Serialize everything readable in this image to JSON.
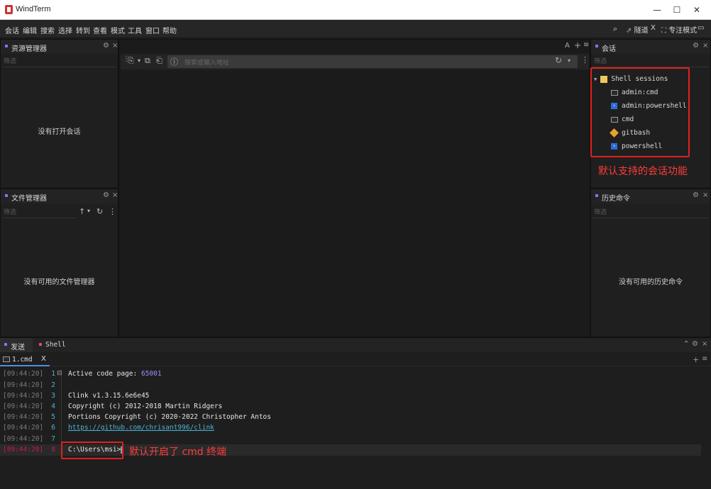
{
  "window": {
    "title": "WindTerm",
    "minimize": "—",
    "maximize": "☐",
    "close": "✕"
  },
  "menu": [
    "会话",
    "编辑",
    "搜索",
    "选择",
    "转到",
    "查看",
    "模式",
    "工具",
    "窗口",
    "帮助"
  ],
  "right_tools": {
    "search": "⌕",
    "tunnel": "隧道",
    "x": "X",
    "focus": "专注模式",
    "layout": "▭"
  },
  "explorer": {
    "title": "资源管理器",
    "filter": "筛选",
    "empty": "没有打开会话"
  },
  "files": {
    "title": "文件管理器",
    "filter": "筛选",
    "empty": "没有可用的文件管理器"
  },
  "center": {
    "address_placeholder": "搜索或输入地址",
    "a_btn": "A",
    "plus_btn": "+",
    "menu_btn": "≡"
  },
  "sessions": {
    "title": "会话",
    "filter": "筛选",
    "root": "Shell sessions",
    "items": [
      {
        "label": "admin:cmd",
        "icon": "cmd-icon"
      },
      {
        "label": "admin:powershell",
        "icon": "powershell-icon"
      },
      {
        "label": "cmd",
        "icon": "cmd-icon"
      },
      {
        "label": "gitbash",
        "icon": "git-icon"
      },
      {
        "label": "powershell",
        "icon": "powershell-icon"
      }
    ],
    "annotation": "默认支持的会话功能"
  },
  "history": {
    "title": "历史命令",
    "filter": "筛选",
    "empty": "没有可用的历史命令"
  },
  "bottom": {
    "tabs": [
      "发送",
      "Shell"
    ],
    "term_tab": "1.cmd",
    "term_tab_close": "X",
    "lines": [
      {
        "ts": "[09:44:20]",
        "n": "1",
        "text": "Active code page: ",
        "value": "65001"
      },
      {
        "ts": "[09:44:20]",
        "n": "2",
        "text": ""
      },
      {
        "ts": "[09:44:20]",
        "n": "3",
        "text": "Clink v1.3.15.6e6e45"
      },
      {
        "ts": "[09:44:20]",
        "n": "4",
        "text": "Copyright (c) 2012-2018 Martin Ridgers"
      },
      {
        "ts": "[09:44:20]",
        "n": "5",
        "text": "Portions Copyright (c) 2020-2022 Christopher Antos"
      },
      {
        "ts": "[09:44:20]",
        "n": "6",
        "text": "https://github.com/chrisant996/clink"
      },
      {
        "ts": "[09:44:20]",
        "n": "7",
        "text": ""
      },
      {
        "ts": "[09:44:20]",
        "n": "8",
        "text": "C:\\Users\\msi>"
      }
    ],
    "annotation": "默认开启了 cmd 终端"
  },
  "colors": {
    "accent_red": "#e02020",
    "link": "#4db2d4",
    "number": "#a78bfa"
  }
}
